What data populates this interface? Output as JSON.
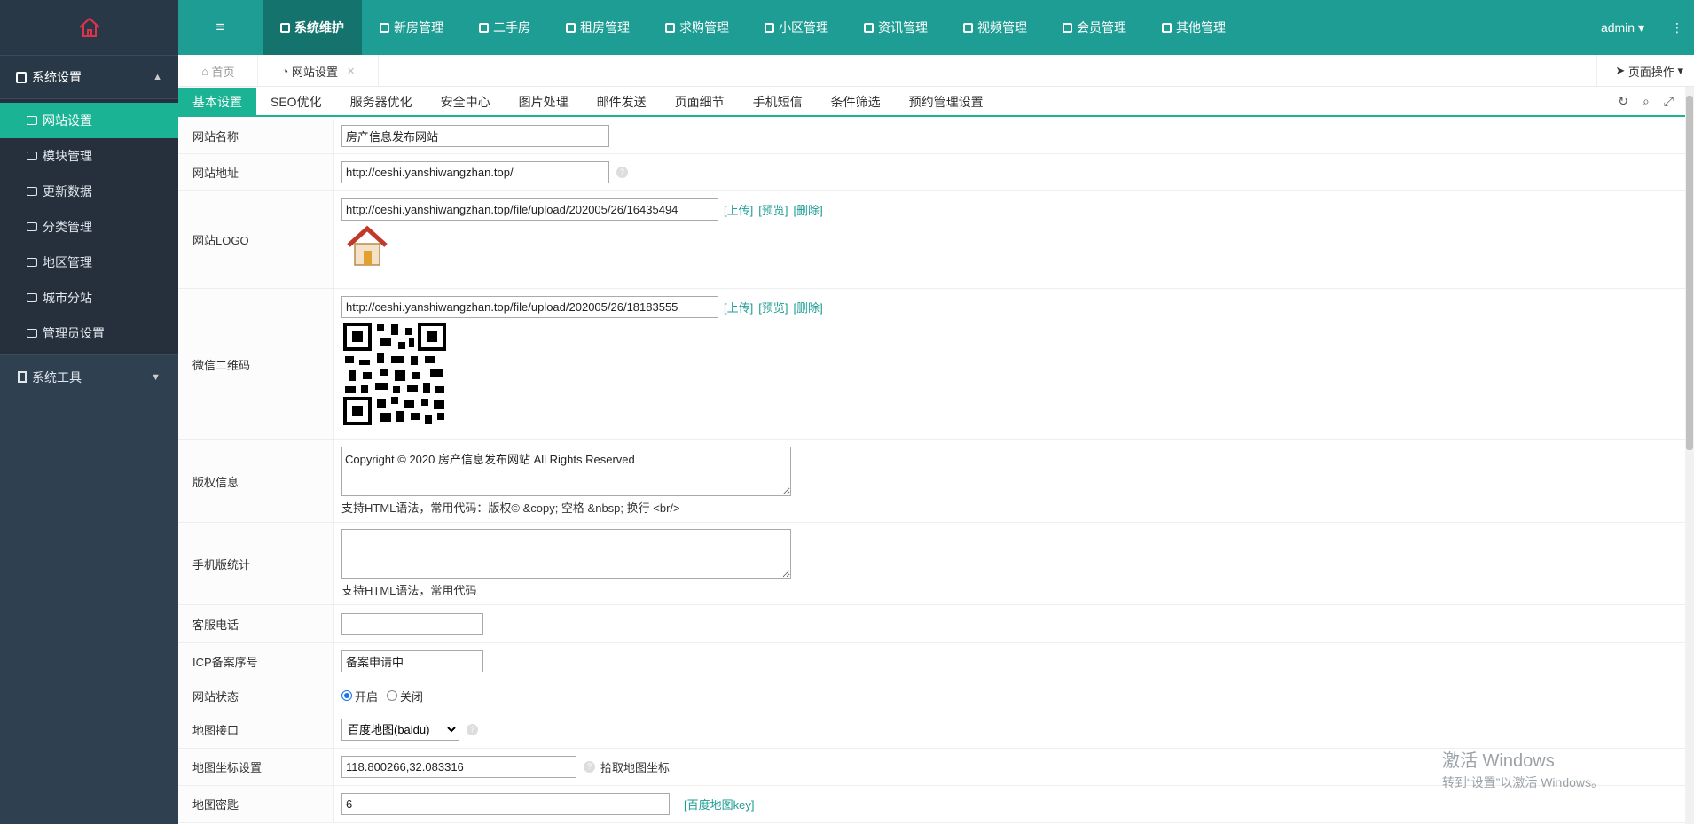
{
  "colors": {
    "accent": "#1ab394",
    "topbar": "#1d9d94",
    "sidebar": "#2f4050"
  },
  "sidebar": {
    "logo_icon": "house-outline-icon",
    "group1": {
      "label": "系统设置",
      "icon": "user-card-icon"
    },
    "items": [
      {
        "label": "网站设置",
        "icon": "dashboard-icon",
        "active": true
      },
      {
        "label": "模块管理",
        "icon": "window-icon"
      },
      {
        "label": "更新数据",
        "icon": "refresh-icon"
      },
      {
        "label": "分类管理",
        "icon": "list-icon"
      },
      {
        "label": "地区管理",
        "icon": "file-icon"
      },
      {
        "label": "城市分站",
        "icon": "snowflake-icon"
      },
      {
        "label": "管理员设置",
        "icon": "gear-icon"
      }
    ],
    "group2": {
      "label": "系统工具",
      "icon": "building-icon"
    }
  },
  "topbar": {
    "toggle_icon": "menu-bars-icon",
    "items": [
      {
        "label": "系统维护",
        "active": true
      },
      {
        "label": "新房管理"
      },
      {
        "label": "二手房"
      },
      {
        "label": "租房管理"
      },
      {
        "label": "求购管理"
      },
      {
        "label": "小区管理"
      },
      {
        "label": "资讯管理"
      },
      {
        "label": "视频管理"
      },
      {
        "label": "会员管理"
      },
      {
        "label": "其他管理"
      }
    ],
    "user": "admin"
  },
  "tabs": {
    "home": "首页",
    "current": "网站设置",
    "page_ops": "页面操作"
  },
  "settings_tabs": [
    "基本设置",
    "SEO优化",
    "服务器优化",
    "安全中心",
    "图片处理",
    "邮件发送",
    "页面细节",
    "手机短信",
    "条件筛选",
    "预约管理设置"
  ],
  "form": {
    "site_name": {
      "label": "网站名称",
      "value": "房产信息发布网站"
    },
    "site_url": {
      "label": "网站地址",
      "value": "http://ceshi.yanshiwangzhan.top/"
    },
    "logo": {
      "label": "网站LOGO",
      "value": "http://ceshi.yanshiwangzhan.top/file/upload/202005/26/16435494",
      "upload": "[上传]",
      "preview": "[预览]",
      "delete": "[删除]"
    },
    "wechat": {
      "label": "微信二维码",
      "value": "http://ceshi.yanshiwangzhan.top/file/upload/202005/26/18183555",
      "upload": "[上传]",
      "preview": "[预览]",
      "delete": "[删除]"
    },
    "copyright": {
      "label": "版权信息",
      "value": "Copyright © 2020 房产信息发布网站 All Rights Reserved",
      "note": "支持HTML语法，常用代码：版权© &copy; 空格 &nbsp; 换行 <br/>"
    },
    "mobile_stats": {
      "label": "手机版统计",
      "value": "",
      "note": "支持HTML语法，常用代码"
    },
    "phone": {
      "label": "客服电话",
      "value": ""
    },
    "icp": {
      "label": "ICP备案序号",
      "value": "备案申请中"
    },
    "status": {
      "label": "网站状态",
      "on": "开启",
      "off": "关闭",
      "selected": "on"
    },
    "map_api": {
      "label": "地图接口",
      "value": "百度地图(baidu)"
    },
    "map_coord": {
      "label": "地图坐标设置",
      "value": "118.800266,32.083316",
      "pick": "拾取地图坐标"
    },
    "map_key": {
      "label": "地图密匙",
      "value": "6",
      "link": "[百度地图key]"
    }
  },
  "watermark": {
    "line1": "激活 Windows",
    "line2": "转到“设置”以激活 Windows。"
  }
}
